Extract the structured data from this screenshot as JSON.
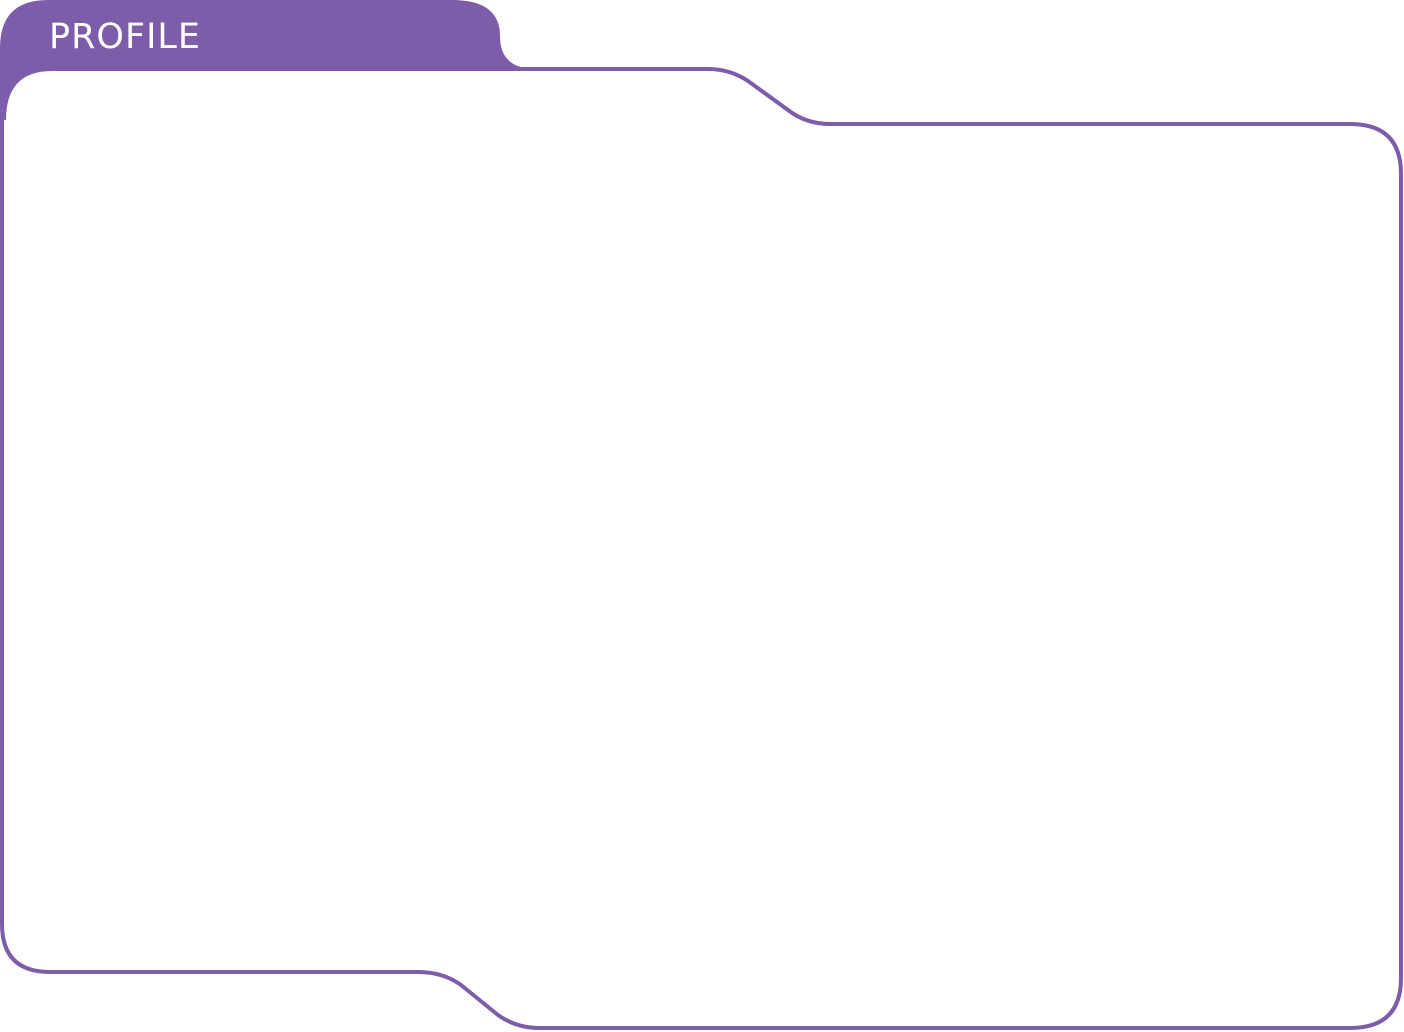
{
  "panel": {
    "title": "PROFILE",
    "accent_color": "#7d5ca9",
    "background_color": "#ffffff"
  }
}
